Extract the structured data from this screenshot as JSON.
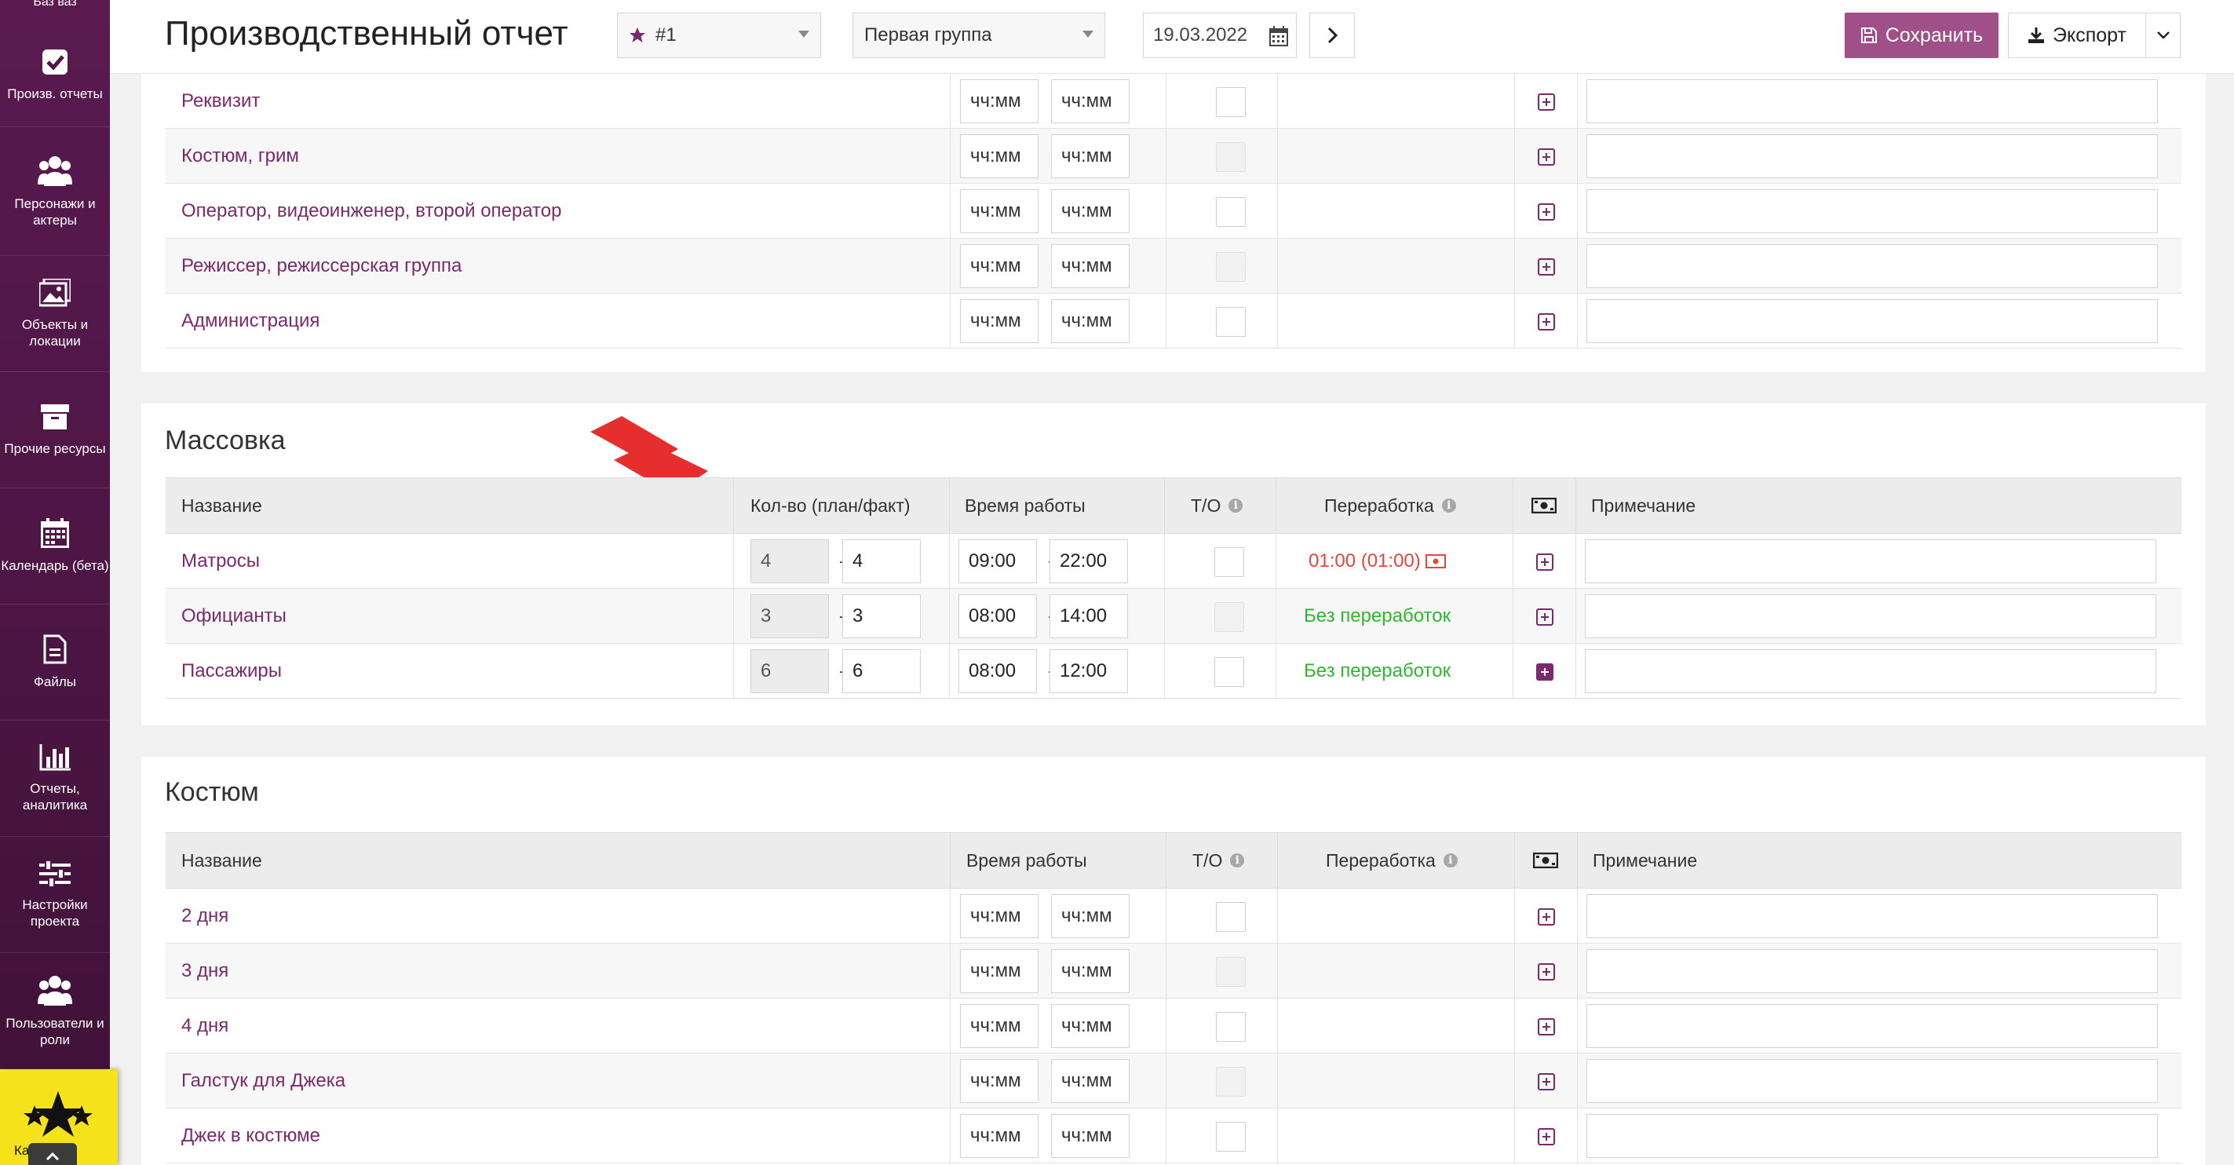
{
  "sidebar": {
    "top_label": "Баз ваз",
    "items": [
      {
        "label": "Произв. отчеты",
        "icon": "check-square-icon"
      },
      {
        "label": "Персонажи и актеры",
        "icon": "users-icon"
      },
      {
        "label": "Объекты и локации",
        "icon": "image-icon"
      },
      {
        "label": "Прочие ресурсы",
        "icon": "archive-icon"
      },
      {
        "label": "Календарь (бета)",
        "icon": "calendar-icon"
      },
      {
        "label": "Файлы",
        "icon": "file-icon"
      },
      {
        "label": "Отчеты, аналитика",
        "icon": "bar-chart-icon"
      },
      {
        "label": "Настройки проекта",
        "icon": "sliders-icon"
      },
      {
        "label": "Пользователи и роли",
        "icon": "users-icon"
      }
    ],
    "bottom_label": "Ка        аза"
  },
  "header": {
    "title": "Производственный отчет",
    "report_select": "#1",
    "group_select": "Первая группа",
    "date": "19.03.2022",
    "save_label": "Сохранить",
    "export_label": "Экспорт"
  },
  "colors": {
    "accent": "#7a2a6c",
    "save": "#a05088",
    "overtime_red": "#e8463a",
    "ok_green": "#2eb82e",
    "sidebar": "#4e1746"
  },
  "placeholder_time": "чч:мм",
  "crew_rows": [
    {
      "name": "Реквизит"
    },
    {
      "name": "Костюм, грим"
    },
    {
      "name": "Оператор, видеоинженер, второй оператор"
    },
    {
      "name": "Режиссер, режиссерская группа"
    },
    {
      "name": "Администрация"
    }
  ],
  "massovka": {
    "title": "Массовка",
    "headers": {
      "name": "Название",
      "qty": "Кол-во (план/факт)",
      "time": "Время работы",
      "to": "Т/О",
      "overtime": "Переработка",
      "note": "Примечание"
    },
    "rows": [
      {
        "name": "Матросы",
        "plan": "4",
        "fact": "4",
        "start": "09:00",
        "end": "22:00",
        "overtime": "01:00 (01:00)"
      },
      {
        "name": "Официанты",
        "plan": "3",
        "fact": "3",
        "start": "08:00",
        "end": "14:00",
        "overtime": "Без переработок"
      },
      {
        "name": "Пассажиры",
        "plan": "6",
        "fact": "6",
        "start": "08:00",
        "end": "12:00",
        "overtime": "Без переработок"
      }
    ]
  },
  "kostyum": {
    "title": "Костюм",
    "headers": {
      "name": "Название",
      "time": "Время работы",
      "to": "Т/О",
      "overtime": "Переработка",
      "note": "Примечание"
    },
    "rows": [
      {
        "name": "2 дня"
      },
      {
        "name": "3 дня"
      },
      {
        "name": "4 дня"
      },
      {
        "name": "Галстук для Джека"
      },
      {
        "name": "Джек в костюме"
      }
    ]
  }
}
